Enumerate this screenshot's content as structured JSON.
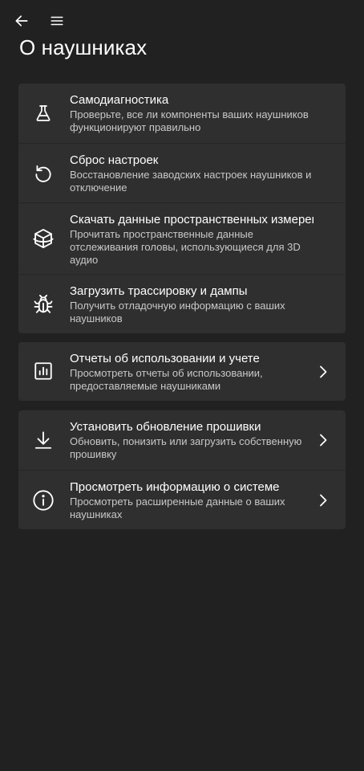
{
  "header": {
    "title": "О наушниках"
  },
  "groups": [
    {
      "items": [
        {
          "icon": "flask-icon",
          "title": "Самодиагностика",
          "subtitle": "Проверьте, все ли компоненты ваших наушников функционируют правильно"
        },
        {
          "icon": "reset-icon",
          "title": "Сброс настроек",
          "subtitle": "Восстановление заводских настроек наушников и отключение"
        },
        {
          "icon": "spatial-audio-icon",
          "title": "Скачать данные пространственных измерен",
          "subtitle": "Прочитать пространственные данные отслеживания головы, использующиеся для 3D аудио"
        },
        {
          "icon": "bug-icon",
          "title": "Загрузить трассировку и дампы",
          "subtitle": "Получить отладочную информацию с ваших наушников"
        }
      ]
    },
    {
      "items": [
        {
          "icon": "bar-chart-icon",
          "title": "Отчеты об использовании и учете",
          "subtitle": "Просмотреть отчеты об использовании, предоставляемые наушниками"
        }
      ]
    },
    {
      "items": [
        {
          "icon": "download-icon",
          "title": "Установить обновление прошивки",
          "subtitle": "Обновить, понизить или загрузить собственную прошивку"
        },
        {
          "icon": "info-icon",
          "title": "Просмотреть информацию о системе",
          "subtitle": "Просмотреть расширенные данные о ваших наушниках"
        }
      ]
    }
  ]
}
